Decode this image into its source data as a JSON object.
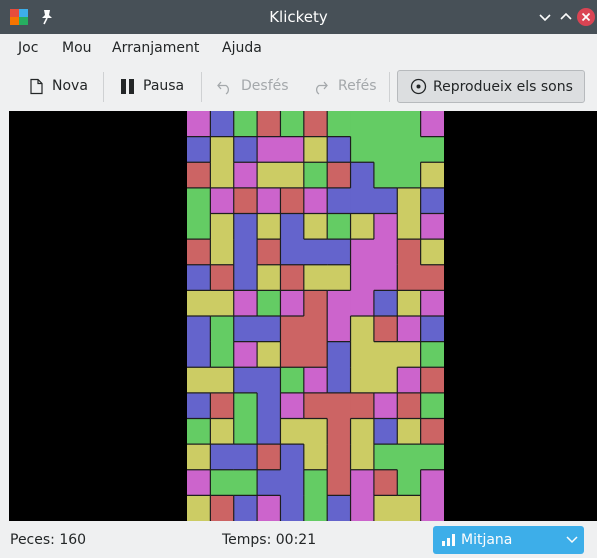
{
  "window": {
    "title": "Klickety"
  },
  "menu": {
    "items": [
      "Joc",
      "Mou",
      "Arranjament",
      "Ajuda"
    ]
  },
  "toolbar": {
    "new_label": "Nova",
    "pause_label": "Pausa",
    "undo_label": "Desfés",
    "redo_label": "Refés",
    "sounds_label": "Reprodueix els sons"
  },
  "board": {
    "palette": {
      "B": "#6464cc",
      "G": "#64cc64",
      "M": "#cc64cc",
      "R": "#cc6464",
      "Y": "#cccc64"
    },
    "rows": [
      "MBGRGRGGGGM",
      "BYBMMYBGGGG",
      "RYMYYGRBGGY",
      "GMRMRMBBBYB",
      "GYBYBYGYMYM",
      "RYBRBBBMMRY",
      "BRBYRYYMMRR",
      "YYMGMRMMBYM",
      "BGBBRRMYRMB",
      "BGMYRRBYYYG",
      "YYBBGMBYYMR",
      "BRGBMRRRMRG",
      "GYGBYYRYBYR",
      "YBBRBYRYGGG",
      "MGGBBGRMRGM",
      "YRBMBGBMYYM"
    ]
  },
  "status": {
    "pieces_text": "Peces: 160",
    "time_text": "Temps: 00:21",
    "difficulty": "Mitjana"
  }
}
